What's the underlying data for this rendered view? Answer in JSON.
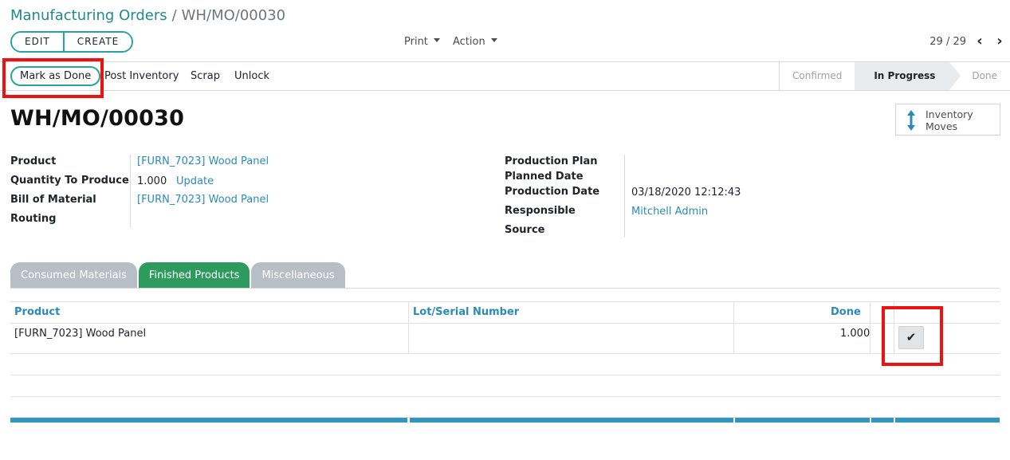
{
  "breadcrumb": {
    "parent": "Manufacturing Orders",
    "separator": "/",
    "current": "WH/MO/00030"
  },
  "control_panel": {
    "edit_label": "EDIT",
    "create_label": "CREATE",
    "print_label": "Print",
    "action_label": "Action",
    "pager_value": "29 / 29",
    "prev_icon": "chevron-left-icon",
    "next_icon": "chevron-right-icon"
  },
  "statusbar": {
    "buttons": {
      "mark_as_done": "Mark as Done",
      "post_inventory": "Post Inventory",
      "scrap": "Scrap",
      "unlock": "Unlock"
    },
    "stages": [
      {
        "label": "Confirmed",
        "state": "past"
      },
      {
        "label": "In Progress",
        "state": "current"
      },
      {
        "label": "Done",
        "state": "future"
      }
    ]
  },
  "sheet": {
    "title": "WH/MO/00030",
    "smart_button": {
      "line1": "Inventory",
      "line2": "Moves",
      "icon": "up-down-arrows-icon",
      "icon_color": "#2b8ab8"
    },
    "left_fields": [
      {
        "label": "Product",
        "value": "[FURN_7023] Wood Panel",
        "is_link": true
      },
      {
        "label": "Quantity To Produce",
        "value": "1.000",
        "action": "Update"
      },
      {
        "label": "Bill of Material",
        "value": "[FURN_7023] Wood Panel",
        "is_link": true
      },
      {
        "label": "Routing",
        "value": ""
      }
    ],
    "right_fields": [
      {
        "label": "Production Plan",
        "value": ""
      },
      {
        "label": "Planned Date",
        "value": ""
      },
      {
        "label": "Production Date",
        "value": "03/18/2020 12:12:43"
      },
      {
        "label": "Responsible",
        "value": "Mitchell Admin",
        "is_link": true
      },
      {
        "label": "Source",
        "value": ""
      }
    ]
  },
  "notebook": {
    "tabs": [
      {
        "label": "Consumed Materials",
        "active": false
      },
      {
        "label": "Finished Products",
        "active": true
      },
      {
        "label": "Miscellaneous",
        "active": false
      }
    ],
    "table": {
      "columns": [
        "Product",
        "Lot/Serial Number",
        "Done"
      ],
      "rows": [
        {
          "product": "[FURN_7023] Wood Panel",
          "lot": "",
          "done": "1.000",
          "action_icon": "checkmark-icon"
        }
      ]
    }
  },
  "colors": {
    "accent_teal": "#2aa3a0",
    "link_blue": "#2b8ab8",
    "active_tab_green": "#2e9b5e",
    "inactive_tab_gray": "#b8bec5",
    "highlight_red": "#ee1111"
  }
}
